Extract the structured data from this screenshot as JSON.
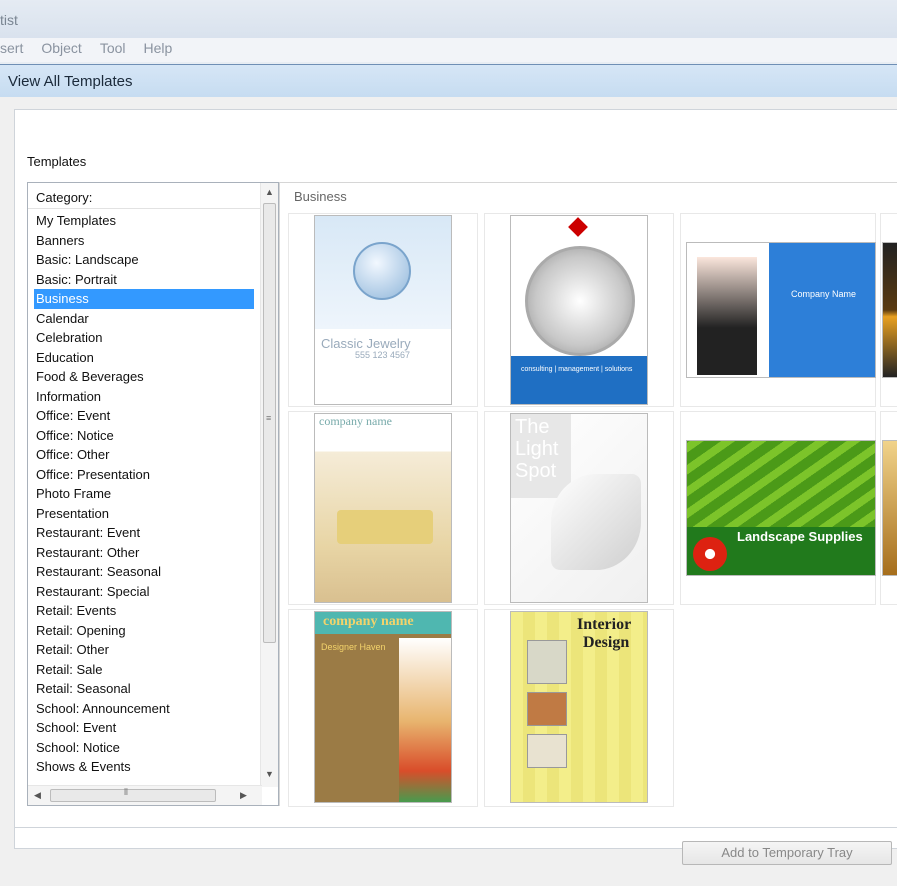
{
  "app": {
    "title_fragment": "tist"
  },
  "menu": [
    "sert",
    "Object",
    "Tool",
    "Help"
  ],
  "dialog": {
    "title": "View All Templates",
    "templates_label": "Templates",
    "category_header": "Category:",
    "categories": [
      "My Templates",
      "Banners",
      "Basic: Landscape",
      "Basic: Portrait",
      "Business",
      "Calendar",
      "Celebration",
      "Education",
      "Food & Beverages",
      "Information",
      "Office: Event",
      "Office: Notice",
      "Office: Other",
      "Office: Presentation",
      "Photo Frame",
      "Presentation",
      "Restaurant: Event",
      "Restaurant: Other",
      "Restaurant: Seasonal",
      "Restaurant: Special",
      "Retail: Events",
      "Retail: Opening",
      "Retail: Other",
      "Retail: Sale",
      "Retail: Seasonal",
      "School: Announcement",
      "School: Event",
      "School: Notice",
      "Shows & Events"
    ],
    "selected_category": "Business",
    "gallery_label": "Business",
    "add_button": "Add to Temporary Tray"
  },
  "thumbnails": {
    "t1": {
      "title": "Classic Jewelry",
      "phone": "555 123 4567"
    },
    "t2": {
      "tagline": "consulting | management | solutions"
    },
    "t3": {
      "company": "Company Name"
    },
    "t5": {
      "company": "company name"
    },
    "t6": {
      "line1": "The",
      "line2": "Light",
      "line3": "Spot"
    },
    "t7": {
      "title": "Landscape Supplies"
    },
    "t8": {
      "company": "company name",
      "subtitle": "Designer Haven"
    },
    "t9": {
      "line1": "Interior",
      "line2": "Design"
    }
  },
  "colors": {
    "selection": "#3399ff",
    "title_bar": "#c6dcf1"
  }
}
